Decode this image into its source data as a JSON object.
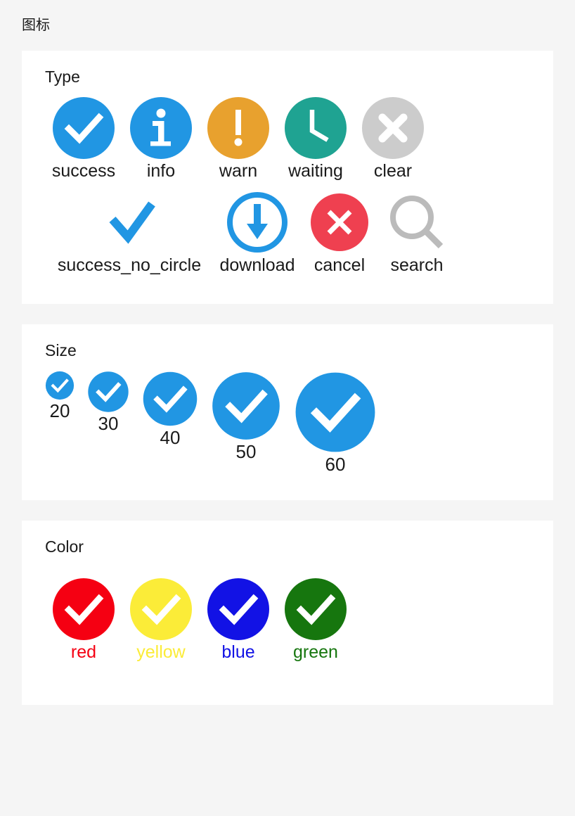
{
  "page": {
    "title": "图标",
    "background": "#f5f5f5",
    "card_background": "#ffffff"
  },
  "sections": {
    "type": {
      "heading": "Type",
      "row1": [
        {
          "name": "success",
          "label": "success",
          "icon": "check-circle-icon",
          "color": "#2196e3",
          "glyph": "check"
        },
        {
          "name": "info",
          "label": "info",
          "icon": "info-circle-icon",
          "color": "#2196e3",
          "glyph": "info"
        },
        {
          "name": "warn",
          "label": "warn",
          "icon": "warning-circle-icon",
          "color": "#e8a12e",
          "glyph": "exclamation"
        },
        {
          "name": "waiting",
          "label": "waiting",
          "icon": "clock-circle-icon",
          "color": "#1fa392",
          "glyph": "clock"
        },
        {
          "name": "clear",
          "label": "clear",
          "icon": "clear-circle-icon",
          "color": "#cccccc",
          "glyph": "x-thick"
        }
      ],
      "row2": [
        {
          "name": "success_no_circle",
          "label": "success_no_circle",
          "icon": "check-icon",
          "color": "#2196e3",
          "glyph": "check-plain"
        },
        {
          "name": "download",
          "label": "download",
          "icon": "download-circle-icon",
          "color": "#2196e3",
          "glyph": "download"
        },
        {
          "name": "cancel",
          "label": "cancel",
          "icon": "cancel-circle-icon",
          "color": "#ef4050",
          "glyph": "x-thin"
        },
        {
          "name": "search",
          "label": "search",
          "icon": "search-icon",
          "color": "#bbbbbb",
          "glyph": "magnifier"
        }
      ]
    },
    "size": {
      "heading": "Size",
      "items": [
        {
          "label": "20",
          "size": 42,
          "color": "#2196e3",
          "icon": "check-circle-icon"
        },
        {
          "label": "30",
          "size": 60,
          "color": "#2196e3",
          "icon": "check-circle-icon"
        },
        {
          "label": "40",
          "size": 80,
          "color": "#2196e3",
          "icon": "check-circle-icon"
        },
        {
          "label": "50",
          "size": 100,
          "color": "#2196e3",
          "icon": "check-circle-icon"
        },
        {
          "label": "60",
          "size": 118,
          "color": "#2196e3",
          "icon": "check-circle-icon"
        }
      ]
    },
    "color": {
      "heading": "Color",
      "items": [
        {
          "label": "red",
          "color": "#f50012",
          "icon": "check-circle-icon"
        },
        {
          "label": "yellow",
          "color": "#fbec38",
          "icon": "check-circle-icon"
        },
        {
          "label": "blue",
          "color": "#1212e5",
          "icon": "check-circle-icon"
        },
        {
          "label": "green",
          "color": "#16760e",
          "icon": "check-circle-icon"
        }
      ]
    }
  }
}
